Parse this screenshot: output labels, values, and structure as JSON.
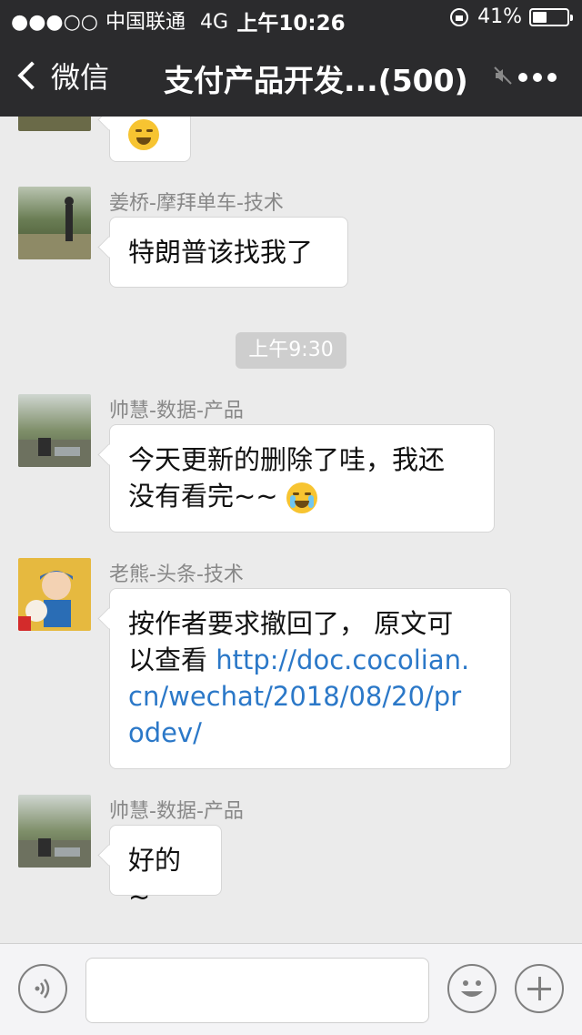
{
  "status_bar": {
    "signal": "●●●○○",
    "carrier": "中国联通",
    "network": "4G",
    "time": "上午10:26",
    "battery": "41%",
    "battery_level": 0.41
  },
  "nav": {
    "back_label": "微信",
    "title": "支付产品开发...(500)"
  },
  "messages": [
    {
      "sender": "姜桥-摩拜单车-技术",
      "text": "特朗普该找我了"
    },
    {
      "timestamp": "上午9:30"
    },
    {
      "sender": "帅慧-数据-产品",
      "text_line1": "今天更新的删除了哇，我还",
      "text_line2": "没有看完~~",
      "emoji": "crying-face"
    },
    {
      "sender": "老熊-头条-技术",
      "text_line1": "按作者要求撤回了， 原文可",
      "text_line2": "以查看 ",
      "link_line1": "http://doc.cocolian.",
      "link_line2": "cn/wechat/2018/08/20/pr",
      "link_line3": "odev/"
    },
    {
      "sender": "帅慧-数据-产品",
      "text": "好的~"
    }
  ],
  "colors": {
    "header_bg": "#2b2b2d",
    "chat_bg": "#ebebeb",
    "link": "#2b78c8"
  },
  "icons": [
    "chevron-left-icon",
    "mute-icon",
    "more-icon",
    "voice-icon",
    "emoji-icon",
    "plus-icon"
  ]
}
